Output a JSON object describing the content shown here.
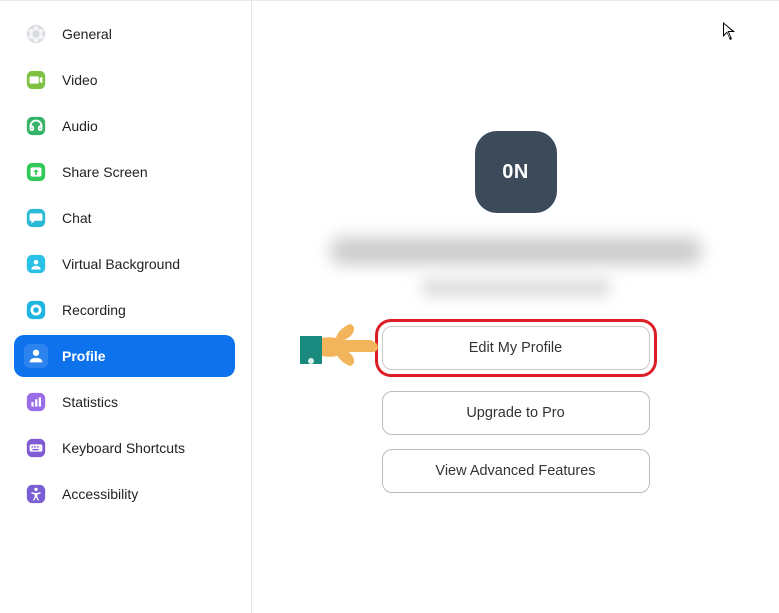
{
  "sidebar": {
    "items": [
      {
        "label": "General"
      },
      {
        "label": "Video"
      },
      {
        "label": "Audio"
      },
      {
        "label": "Share Screen"
      },
      {
        "label": "Chat"
      },
      {
        "label": "Virtual Background"
      },
      {
        "label": "Recording"
      },
      {
        "label": "Profile"
      },
      {
        "label": "Statistics"
      },
      {
        "label": "Keyboard Shortcuts"
      },
      {
        "label": "Accessibility"
      }
    ]
  },
  "profile": {
    "avatar_initials": "0N",
    "buttons": {
      "edit": "Edit My Profile",
      "upgrade": "Upgrade to Pro",
      "advanced": "View Advanced Features"
    }
  },
  "colors": {
    "accent": "#0e72ed",
    "highlight": "#da1f26",
    "avatar_bg": "#3c4a5a",
    "hand_skin": "#f3b55c",
    "hand_sleeve": "#1a8a7e"
  }
}
